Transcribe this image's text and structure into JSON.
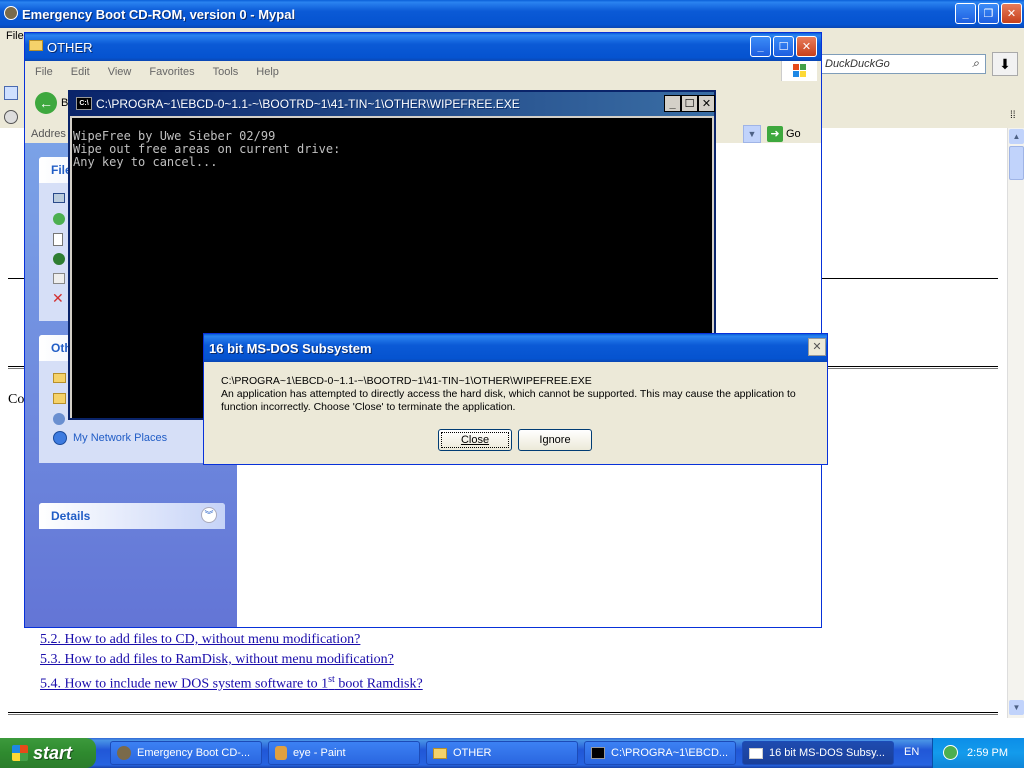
{
  "mypal": {
    "title": "Emergency Boot CD-ROM, version 0 - Mypal",
    "menu_file": "File",
    "search_placeholder": "DuckDuckGo",
    "page_left_fragment": "Co",
    "links": [
      {
        "text": "5.2. How to add files to CD, without menu modification?"
      },
      {
        "text": "5.3. How to add files to RamDisk, without menu modification?"
      },
      {
        "text_pre": "5.4. How to include new DOS system software to 1",
        "sup": "st",
        "text_post": " boot Ramdisk?"
      }
    ]
  },
  "explorer": {
    "title": "OTHER",
    "menu": [
      "File",
      "Edit",
      "View",
      "Favorites",
      "Tools",
      "Help"
    ],
    "back_fragment": "B",
    "address_fragment": "Addres",
    "go_label": "Go",
    "panel_file_fragment": "File",
    "panel_other_fragment": "Oth",
    "my_network_places": "My Network Places",
    "details_label": "Details"
  },
  "console": {
    "title": "C:\\PROGRA~1\\EBCD-0~1.1-~\\BOOTRD~1\\41-TIN~1\\OTHER\\WIPEFREE.EXE",
    "lines": [
      "WipeFree by Uwe Sieber 02/99",
      "Wipe out free areas on current drive:",
      "Any key to cancel..."
    ]
  },
  "dialog": {
    "title": "16 bit MS-DOS Subsystem",
    "path": "C:\\PROGRA~1\\EBCD-0~1.1-~\\BOOTRD~1\\41-TIN~1\\OTHER\\WIPEFREE.EXE",
    "message_1": "An application has attempted to directly access the hard disk, which cannot be supported. This may cause the application to",
    "message_2": "function incorrectly. Choose 'Close' to terminate the application.",
    "close_label": "Close",
    "ignore_label": "Ignore"
  },
  "taskbar": {
    "start_label": "start",
    "items": [
      {
        "label": "Emergency Boot CD-..."
      },
      {
        "label": "eye - Paint"
      },
      {
        "label": "OTHER"
      },
      {
        "label": "C:\\PROGRA~1\\EBCD..."
      },
      {
        "label": "16 bit MS-DOS Subsy..."
      }
    ],
    "language": "EN",
    "clock": "2:59 PM"
  }
}
